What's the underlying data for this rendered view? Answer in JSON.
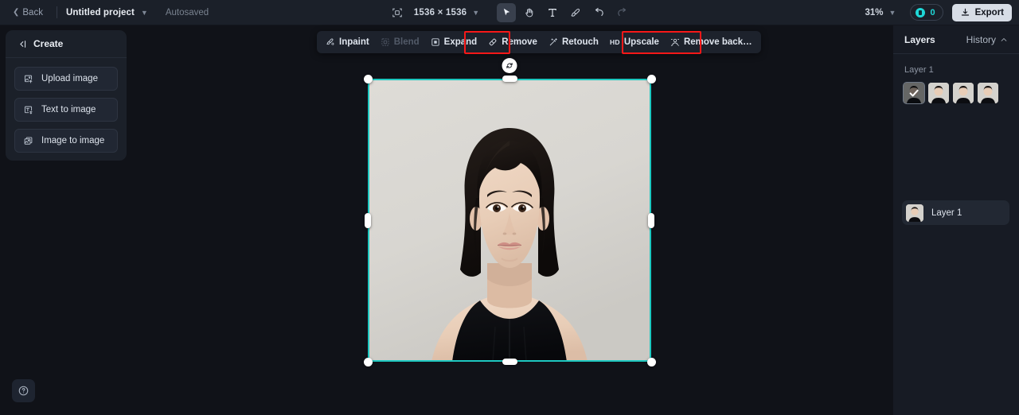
{
  "topbar": {
    "back_label": "Back",
    "project_name": "Untitled project",
    "autosaved_label": "Autosaved",
    "canvas_size": "1536 × 1536",
    "zoom_level": "31%",
    "credits_count": "0",
    "export_label": "Export",
    "tools": [
      {
        "name": "select-tool",
        "icon": "cursor-icon",
        "active": true
      },
      {
        "name": "hand-tool",
        "icon": "hand-icon",
        "active": false
      },
      {
        "name": "text-tool",
        "icon": "text-icon",
        "active": false
      },
      {
        "name": "brush-tool",
        "icon": "brush-icon",
        "active": false
      },
      {
        "name": "undo",
        "icon": "undo-icon",
        "active": false
      },
      {
        "name": "redo",
        "icon": "redo-icon",
        "active": false
      }
    ]
  },
  "left_panel": {
    "title": "Create",
    "collapse_icon": "collapse-left-icon",
    "buttons": [
      {
        "label": "Upload image",
        "icon": "upload-image-icon"
      },
      {
        "label": "Text to image",
        "icon": "text-to-image-icon"
      },
      {
        "label": "Image to image",
        "icon": "image-to-image-icon"
      }
    ]
  },
  "help": {
    "icon": "help-question-icon"
  },
  "toolbar": {
    "items": [
      {
        "label": "Inpaint",
        "icon": "inpaint-icon",
        "disabled": false,
        "highlighted": false
      },
      {
        "label": "Blend",
        "icon": "blend-icon",
        "disabled": true,
        "highlighted": false
      },
      {
        "label": "Expand",
        "icon": "expand-icon",
        "disabled": false,
        "highlighted": false
      },
      {
        "label": "Remove",
        "icon": "remove-eraser-icon",
        "disabled": false,
        "highlighted": true
      },
      {
        "label": "Retouch",
        "icon": "retouch-wand-icon",
        "disabled": false,
        "highlighted": false
      },
      {
        "label": "Upscale",
        "icon": "hd-badge",
        "disabled": false,
        "highlighted": false,
        "prefix": "HD"
      },
      {
        "label": "Remove back…",
        "icon": "remove-background-icon",
        "disabled": false,
        "highlighted": true
      }
    ],
    "highlight_color": "#f81818"
  },
  "canvas": {
    "selection_color": "#1ec8c0",
    "rotate_icon": "rotate-icon",
    "image_alt": "portrait-photo",
    "image_bg_color": "#d9d8d4"
  },
  "right_panel": {
    "tab_layers": "Layers",
    "tab_history": "History",
    "history_chevron_icon": "chevron-up-icon",
    "section_label": "Layer 1",
    "thumbnails": [
      {
        "name": "variant-1",
        "selected": true
      },
      {
        "name": "variant-2",
        "selected": false
      },
      {
        "name": "variant-3",
        "selected": false
      },
      {
        "name": "variant-4",
        "selected": false
      }
    ],
    "layers": [
      {
        "name": "Layer 1"
      }
    ]
  }
}
